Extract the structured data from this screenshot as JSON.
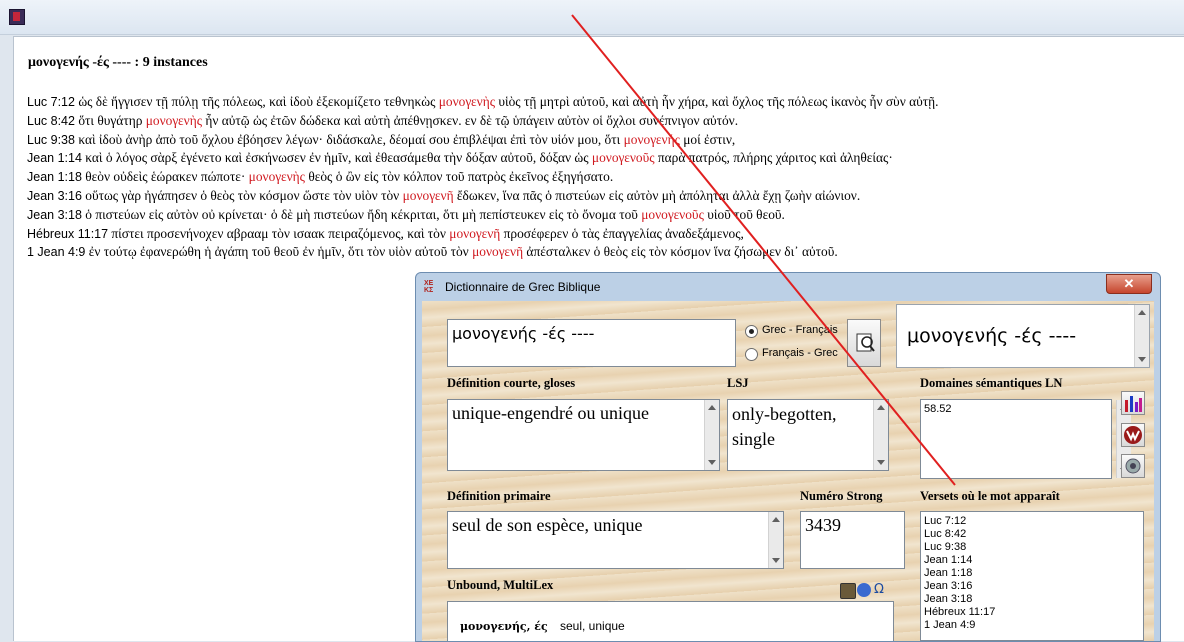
{
  "window": {
    "icon": "app-icon"
  },
  "document": {
    "heading": "μονογενής -ές ---- : 9 instances",
    "verses": [
      {
        "ref": "Luc 7:12",
        "pre": " ὡς δὲ ἤγγισεν τῇ πύλῃ τῆς πόλεως, καὶ ἰδοὺ ἐξεκομίζετο τεθνηκὼς ",
        "hl": "μονογενὴς",
        "post": " υἱὸς τῇ μητρὶ αὐτοῦ, καὶ αὐτὴ ἦν χήρα, καὶ ὄχλος τῆς πόλεως ἱκανὸς ἦν σὺν αὐτῇ."
      },
      {
        "ref": "Luc 8:42",
        "pre": " ὅτι θυγάτηρ ",
        "hl": "μονογενὴς",
        "post": " ἦν αὐτῷ ὡς ἐτῶν δώδεκα καὶ αὐτὴ ἀπέθνῃσκεν. εν δὲ τῷ ὑπάγειν αὐτὸν οἱ ὄχλοι συνέπνιγον αὐτόν."
      },
      {
        "ref": "Luc 9:38",
        "pre": " καὶ ἰδοὺ ἀνὴρ ἀπὸ τοῦ ὄχλου ἐβόησεν λέγων· διδάσκαλε, δέομαί σου ἐπιβλέψαι ἐπὶ τὸν υἱόν μου, ὅτι ",
        "hl": "μονογενής",
        "post": " μοί ἐστιν,"
      },
      {
        "ref": "Jean 1:14",
        "pre": " καὶ ὁ λόγος σὰρξ ἐγένετο καὶ ἐσκήνωσεν ἐν ἡμῖν, καὶ ἐθεασάμεθα τὴν δόξαν αὐτοῦ, δόξαν ὡς ",
        "hl": "μονογενοῦς",
        "post": " παρὰ πατρός, πλήρης χάριτος καὶ ἀληθείας·"
      },
      {
        "ref": "Jean 1:18",
        "pre": " θεὸν οὐδεὶς ἑώρακεν πώποτε· ",
        "hl": "μονογενὴς",
        "post": " θεὸς ὁ ὢν εἰς τὸν κόλπον τοῦ πατρὸς ἐκεῖνος ἐξηγήσατο."
      },
      {
        "ref": "Jean 3:16",
        "pre": " οὕτως γὰρ ἠγάπησεν ὁ θεὸς τὸν κόσμον ὥστε τὸν υἱὸν τὸν ",
        "hl": "μονογενῆ",
        "post": " ἔδωκεν, ἵνα πᾶς ὁ πιστεύων εἰς αὐτὸν μὴ ἀπόληται ἀλλὰ ἔχῃ ζωὴν αἰώνιον."
      },
      {
        "ref": "Jean 3:18",
        "pre": " ὁ πιστεύων εἰς αὐτὸν οὐ κρίνεται· ὁ δὲ μὴ πιστεύων ἤδη κέκριται, ὅτι μὴ πεπίστευκεν εἰς τὸ ὄνομα τοῦ ",
        "hl": "μονογενοῦς",
        "post": " υἱοῦ τοῦ θεοῦ."
      },
      {
        "ref": "Hébreux 11:17",
        "pre": " πίστει προσενήνοχεν αβρααμ τὸν ισαακ πειραζόμενος, καὶ τὸν ",
        "hl": "μονογενῆ",
        "post": " προσέφερεν ὁ τὰς ἐπαγγελίας ἀναδεξάμενος,"
      },
      {
        "ref": "1 Jean 4:9",
        "pre": " ἐν τούτῳ ἐφανερώθη ἡ ἀγάπη τοῦ θεοῦ ἐν ἡμῖν, ὅτι τὸν υἱὸν αὐτοῦ τὸν ",
        "hl": "μονογενῆ",
        "post": " ἀπέσταλκεν ὁ θεὸς εἰς τὸν κόσμον ἵνα ζήσωμεν δι᾽ αὐτοῦ."
      }
    ]
  },
  "dialog": {
    "title": "Dictionnaire de Grec Biblique",
    "icon_text": "ΧΕ ΚΣ",
    "close_glyph": "✕",
    "search_value": "μονογενής -ές ----",
    "radio_grec": "Grec - Français",
    "radio_fr": "Français - Grec",
    "display_word": "μονογενής -ές ----",
    "label_short": "Définition courte, gloses",
    "short_def": "unique-engendré ou unique",
    "label_lsj": "LSJ",
    "lsj": "only-begotten, single",
    "label_domains": "Domaines sémantiques LN",
    "domains": "58.52",
    "label_primary": "Définition primaire",
    "primary_def": "seul de son espèce, unique",
    "label_strong": "Numéro Strong",
    "strong": "3439",
    "label_verses": "Versets où le mot apparaît",
    "verse_list": [
      "Luc 7:12",
      "Luc 8:42",
      "Luc 9:38",
      "Jean 1:14",
      "Jean 1:18",
      "Jean 3:16",
      "Jean 3:18",
      "Hébreux 11:17",
      "1 Jean 4:9"
    ],
    "label_unbound": "Unbound, MultiLex",
    "unbound_word": "μονογενής, ές",
    "unbound_def": "seul, unique"
  },
  "colors": {
    "highlight": "#d0191f",
    "annotation_line": "#e02020"
  }
}
